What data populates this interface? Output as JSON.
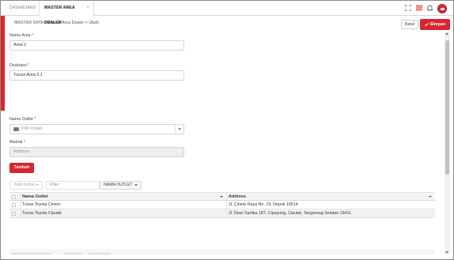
{
  "tabs": [
    {
      "label": "DASHBOARD",
      "active": false
    },
    {
      "label": "MASTER AREA DEALER",
      "active": true,
      "close": "×"
    }
  ],
  "topbar_icons": [
    "expand-icon",
    "menu-icon",
    "bell-icon",
    "avatar"
  ],
  "breadcrumb": "MASTER DATA > Master Area Dealer > Ubah",
  "actions": {
    "cancel": "Batal",
    "save": "Simpan"
  },
  "form": {
    "nama_area": {
      "label": "Nama Area",
      "required": "*",
      "value": "Area 2"
    },
    "deskripsi": {
      "label": "Deskripsi",
      "required": "*",
      "value": "Tunas Area 2.1"
    },
    "nama_outlet": {
      "label": "Nama Outlet",
      "required": "*",
      "placeholder": "Pilih Outlet"
    },
    "alamat": {
      "label": "Alamat",
      "required": "*",
      "placeholder": "Address"
    }
  },
  "add_button": "Tambah",
  "toolbar": {
    "bulk_action": "Bulk Action",
    "filter_placeholder": "Filter",
    "filter_column": "NAMA OUTLET"
  },
  "table": {
    "columns": [
      "Nama Outlet",
      "Address"
    ],
    "rows": [
      {
        "name": "Tunas Toyota Cinere",
        "address": "Jl. Cinere Raya No. 19, Depok 16514"
      },
      {
        "name": "Tunas Toyota Ciputat",
        "address": "Jl. Dewi Sartika 187, Cipayung, Ciputat, Tangerang Selatan 15411"
      }
    ]
  },
  "colors": {
    "accent": "#d7262e"
  }
}
